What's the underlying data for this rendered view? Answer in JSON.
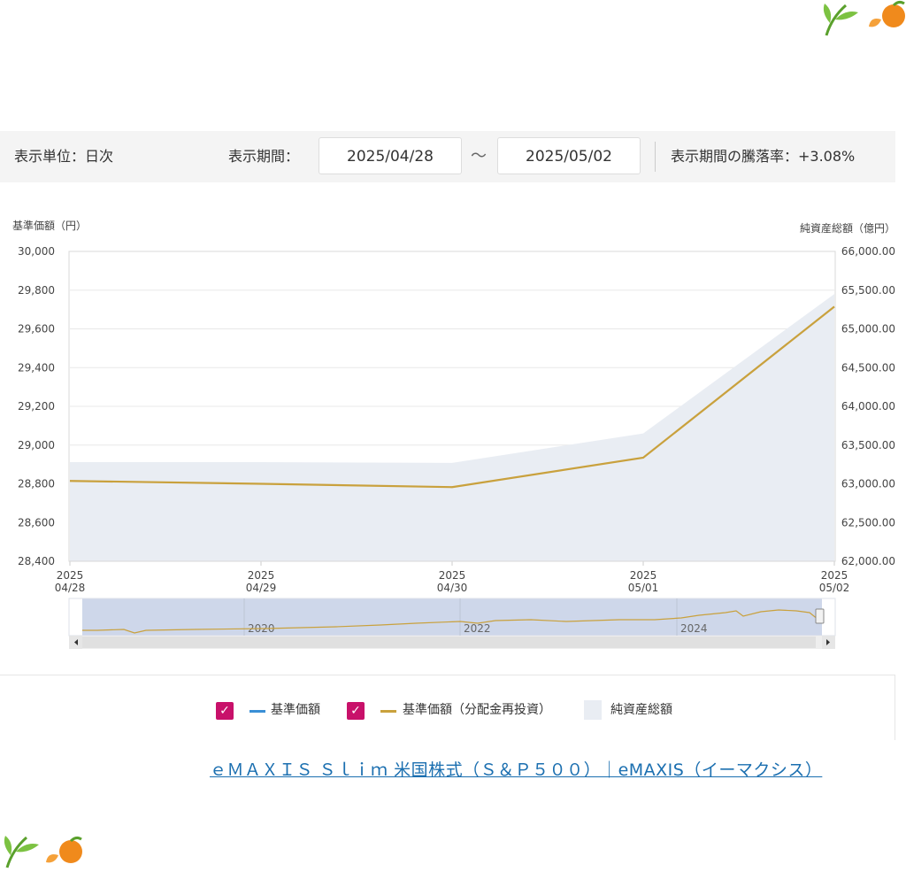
{
  "filter": {
    "unit_label": "表示単位：日次",
    "period_label": "表示期間：",
    "start_date": "2025/04/28",
    "tilde": "～",
    "end_date": "2025/05/02",
    "change_label": "表示期間の騰落率：+3.08%"
  },
  "chart_data": {
    "type": "line",
    "left_axis_title": "基準価額（円）",
    "right_axis_title": "純資産総額（億円）",
    "x_labels": [
      [
        "2025",
        "04/28"
      ],
      [
        "2025",
        "04/29"
      ],
      [
        "2025",
        "04/30"
      ],
      [
        "2025",
        "05/01"
      ],
      [
        "2025",
        "05/02"
      ]
    ],
    "y_left_ticks": [
      "30,000",
      "29,800",
      "29,600",
      "29,400",
      "29,200",
      "29,000",
      "28,800",
      "28,600",
      "28,400"
    ],
    "y_right_ticks": [
      "66,000.00",
      "65,500.00",
      "65,000.00",
      "64,500.00",
      "64,000.00",
      "63,500.00",
      "63,000.00",
      "62,500.00",
      "62,000.00"
    ],
    "ylim_left": [
      28400,
      30000
    ],
    "ylim_right": [
      62000,
      66000
    ],
    "series": [
      {
        "name": "基準価額（分配金再投資）",
        "type": "line",
        "axis": "left",
        "color": "#c9a13d",
        "values": [
          28815,
          28800,
          28783,
          28935,
          29715
        ]
      },
      {
        "name": "純資産総額",
        "type": "area",
        "axis": "right",
        "color": "#e9edf3",
        "values": [
          63280,
          63280,
          63270,
          63650,
          65450
        ]
      }
    ],
    "navigator_labels": [
      "2020",
      "2022",
      "2024"
    ],
    "grid": true
  },
  "legend": {
    "item1_label": "基準価額",
    "item1_color": "#3a8fd6",
    "item2_label": "基準価額（分配金再投資）",
    "item2_color": "#c9a13d",
    "item3_label": "純資産総額"
  },
  "link_text": "ｅＭＡＸＩＳ Ｓｌｉｍ 米国株式（Ｓ＆Ｐ５００）｜eMAXIS（イーマクシス）"
}
